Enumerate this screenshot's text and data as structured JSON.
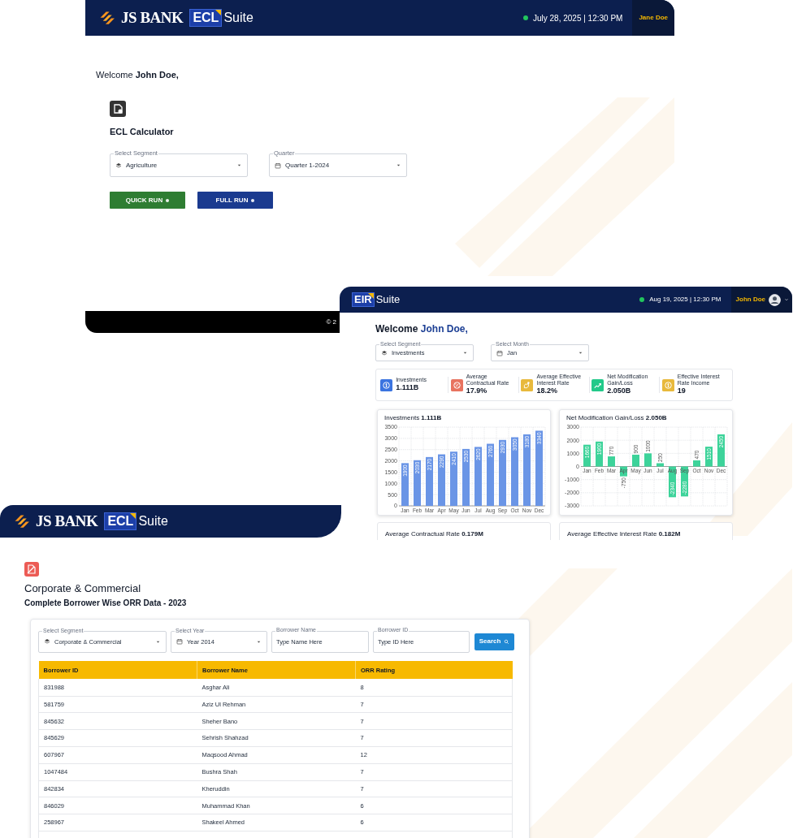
{
  "ecl_window": {
    "header": {
      "brand": "JS BANK",
      "product": "ECL",
      "product_suffix": "Suite",
      "datetime": "July 28, 2025 | 12:30 PM",
      "online": true,
      "user": "Jane Doe"
    },
    "welcome": {
      "greeting": "Welcome",
      "name": "John Doe,"
    },
    "calculator": {
      "title": "ECL Calculator",
      "fields": [
        {
          "kind": "segment",
          "label": "Select Segment",
          "value": "Agriculture"
        },
        {
          "kind": "period",
          "label": "Quarter",
          "value": "Quarter 1-2024"
        }
      ],
      "buttons": [
        {
          "label": "QUICK RUN",
          "color": "#2e7d32"
        },
        {
          "label": "FULL RUN",
          "color": "#1a3a8f"
        }
      ]
    },
    "footer": "© 2"
  },
  "eir_window": {
    "header": {
      "product": "EIR",
      "product_suffix": "Suite",
      "datetime": "Aug 19, 2025 | 12:30 PM",
      "online": true,
      "user": "John Doe"
    },
    "welcome": {
      "greeting": "Welcome",
      "name": "John Doe,"
    },
    "filters": [
      {
        "kind": "segment",
        "label": "Select Segment",
        "value": "Investments"
      },
      {
        "kind": "period",
        "label": "Select Month",
        "value": "Jan"
      }
    ],
    "kpis": [
      {
        "kind": "coin",
        "label": "Investments",
        "value": "1.111B",
        "color": "#3b74e0"
      },
      {
        "kind": "percent",
        "label": "Average Contractual Rate",
        "value": "17.9%",
        "color": "#e8735f"
      },
      {
        "kind": "hand",
        "label": "Average Effective Interest Rate",
        "value": "18.2%",
        "color": "#e8b93c"
      },
      {
        "kind": "trend",
        "label": "Net Modification Gain/Loss",
        "value": "2.050B",
        "color": "#22c98a"
      },
      {
        "kind": "coin",
        "label": "Effective Interest Rate Income",
        "value": "19",
        "color": "#e8b93c"
      }
    ],
    "charts": [
      {
        "title": "Investments **1.111B**",
        "chart_data": {
          "type": "bar",
          "x": [
            "Jan",
            "Feb",
            "Mar",
            "Apr",
            "May",
            "Jun",
            "Jul",
            "Aug",
            "Sep",
            "Oct",
            "Nov",
            "Dec"
          ],
          "grid": true,
          "series": [
            {
              "color": "#6a95e6",
              "values": [
                1900,
                2030,
                2170,
                2290,
                2410,
                2530,
                2620,
                2760,
                2930,
                3050,
                3180,
                3340
              ]
            }
          ],
          "ylim": [
            0,
            3500
          ],
          "yticks": [
            0,
            500,
            1000,
            1500,
            2000,
            2500,
            3000,
            3500
          ],
          "data_labels": true
        }
      },
      {
        "title": "Net Modification Gain/Loss **2.050B**",
        "chart_data": {
          "type": "bar",
          "x": [
            "Jan",
            "Feb",
            "Mar",
            "Apr",
            "May",
            "Jun",
            "Jul",
            "Aug",
            "Sep",
            "Oct",
            "Nov",
            "Dec"
          ],
          "grid": true,
          "series": [
            {
              "color": "#3dd39a",
              "values": [
                1660,
                1900,
                770,
                -750,
                900,
                1000,
                250,
                -2340,
                -2280,
                470,
                1510,
                2450
              ]
            }
          ],
          "ylim": [
            -3000,
            3000
          ],
          "yticks": [
            -3000,
            -2000,
            -1000,
            0,
            1000,
            2000,
            3000
          ],
          "data_labels": true
        }
      }
    ],
    "more_cards": [
      {
        "title": "Average Contractual Rate **0.179M**"
      },
      {
        "title": "Average Effective Interest Rate **0.182M**"
      }
    ]
  },
  "orr_window": {
    "header": {
      "brand": "JS BANK",
      "product": "ECL",
      "product_suffix": "Suite"
    },
    "section_title": "Corporate & Commercial",
    "subtitle": "Complete Borrower Wise ORR Data - 2023",
    "filters": [
      {
        "kind": "segment",
        "label": "Select Segment",
        "value": "Corporate & Commercial"
      },
      {
        "kind": "period",
        "label": "Select Year",
        "value": "Year 2014"
      },
      {
        "kind": "input",
        "label": "Borrower Name",
        "placeholder": "Type Name Here"
      },
      {
        "kind": "input",
        "label": "Borrower ID",
        "placeholder": "Type ID Here"
      }
    ],
    "search_button": "Search",
    "table": {
      "columns": [
        "Borrower ID",
        "Borrower Name",
        "ORR Rating"
      ],
      "rows": [
        [
          "831988",
          "Asghar Ali",
          "8"
        ],
        [
          "581759",
          "Aziz Ul Rehman",
          "7"
        ],
        [
          "845632",
          "Sheher Bano",
          "7"
        ],
        [
          "845629",
          "Sehrish Shahzad",
          "7"
        ],
        [
          "607967",
          "Maqsood Ahmad",
          "12"
        ],
        [
          "1047484",
          "Bushra Shah",
          "7"
        ],
        [
          "842834",
          "Kheruddin",
          "7"
        ],
        [
          "846029",
          "Muhammad Khan",
          "6"
        ],
        [
          "258967",
          "Shakeel Ahmed",
          "6"
        ]
      ]
    }
  }
}
